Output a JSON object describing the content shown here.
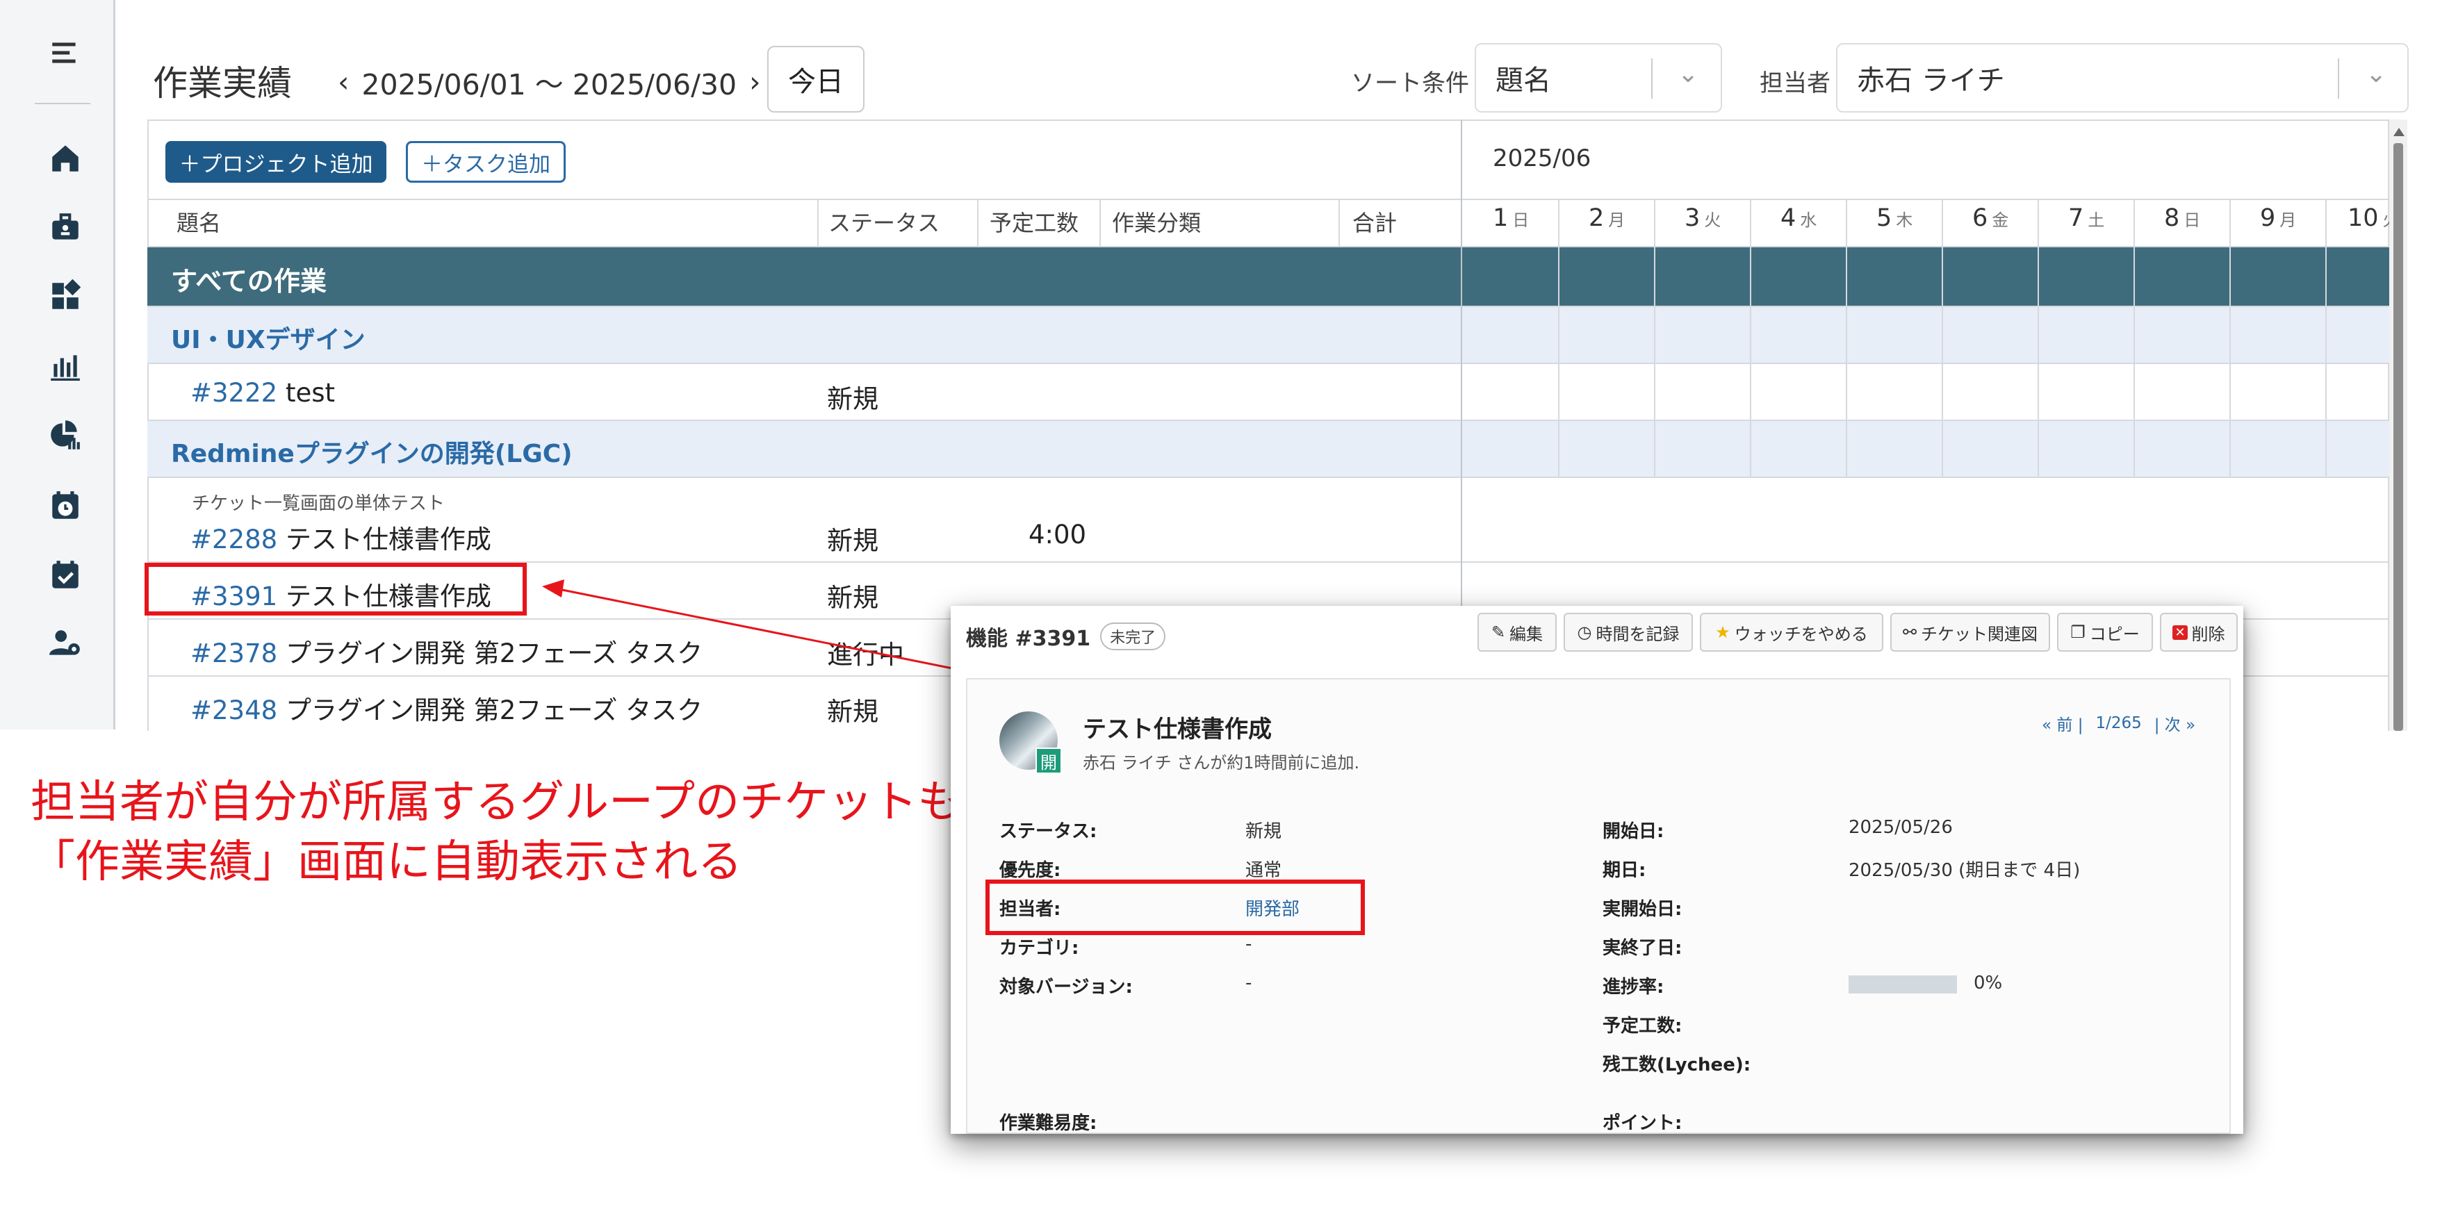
{
  "sidebar": {
    "icons": [
      "menu-icon",
      "home-icon",
      "briefcase-icon",
      "dashboard-icon",
      "bar-chart-icon",
      "pie-chart-icon",
      "calendar-clock-icon",
      "calendar-check-icon",
      "user-settings-icon"
    ]
  },
  "header": {
    "title": "作業実績",
    "date_range": "2025/06/01 ～ 2025/06/30",
    "today_label": "今日",
    "sort_label": "ソート条件",
    "sort_value": "題名",
    "assignee_label": "担当者",
    "assignee_value": "赤石 ライチ"
  },
  "toolbar": {
    "add_project": "＋プロジェクト追加",
    "add_task": "＋タスク追加"
  },
  "columns": [
    "題名",
    "ステータス",
    "予定工数",
    "作業分類",
    "合計"
  ],
  "calendar": {
    "month": "2025/06",
    "days": [
      {
        "n": "1",
        "w": "日"
      },
      {
        "n": "2",
        "w": "月"
      },
      {
        "n": "3",
        "w": "火"
      },
      {
        "n": "4",
        "w": "水"
      },
      {
        "n": "5",
        "w": "木"
      },
      {
        "n": "6",
        "w": "金"
      },
      {
        "n": "7",
        "w": "土"
      },
      {
        "n": "8",
        "w": "日"
      },
      {
        "n": "9",
        "w": "月"
      },
      {
        "n": "10",
        "w": "火"
      }
    ]
  },
  "rows": {
    "all": "すべての作業",
    "group1": "UI・UXデザイン",
    "t1": {
      "id": "#3222",
      "title": "test",
      "status": "新規"
    },
    "group2": "Redmineプラグインの開発(LGC)",
    "t2": {
      "parent": "チケット一覧画面の単体テスト",
      "id": "#2288",
      "title": "テスト仕様書作成",
      "status": "新規",
      "hours": "4:00"
    },
    "t3": {
      "id": "#3391",
      "title": "テスト仕様書作成",
      "status": "新規"
    },
    "t4": {
      "id": "#2378",
      "title": "プラグイン開発 第2フェーズ タスク",
      "status": "進行中"
    },
    "t5": {
      "id": "#2348",
      "title": "プラグイン開発 第2フェーズ タスク",
      "status": "新規"
    }
  },
  "annotation": {
    "line1": "担当者が自分が所属するグループのチケットも",
    "line2": "「作業実績」画面に自動表示される",
    "color": "#e8141b"
  },
  "popup": {
    "ticket": "機能 #3391",
    "state": "未完了",
    "buttons": [
      "編集",
      "時間を記録",
      "ウォッチをやめる",
      "チケット関連図",
      "コピー",
      "削除"
    ],
    "subject": "テスト仕様書作成",
    "author_line": "赤石 ライチ さんが約1時間前に追加.",
    "badge": "開",
    "nav": {
      "prev": "« 前 |",
      "pos": "1/265",
      "next": "| 次 »"
    },
    "fields_left": [
      {
        "label": "ステータス:",
        "value": "新規"
      },
      {
        "label": "優先度:",
        "value": "通常"
      },
      {
        "label": "担当者:",
        "value": "開発部"
      },
      {
        "label": "カテゴリ:",
        "value": "-"
      },
      {
        "label": "対象バージョン:",
        "value": "-"
      },
      {
        "label": "作業難易度:",
        "value": ""
      }
    ],
    "fields_right": [
      {
        "label": "開始日:",
        "value": "2025/05/26"
      },
      {
        "label": "期日:",
        "value": "2025/05/30 (期日まで 4日)"
      },
      {
        "label": "実開始日:",
        "value": ""
      },
      {
        "label": "実終了日:",
        "value": ""
      },
      {
        "label": "進捗率:",
        "value": "0%"
      },
      {
        "label": "予定工数:",
        "value": ""
      },
      {
        "label": "残工数(Lychee):",
        "value": ""
      },
      {
        "label": "ポイント:",
        "value": ""
      }
    ],
    "progress": 0
  }
}
